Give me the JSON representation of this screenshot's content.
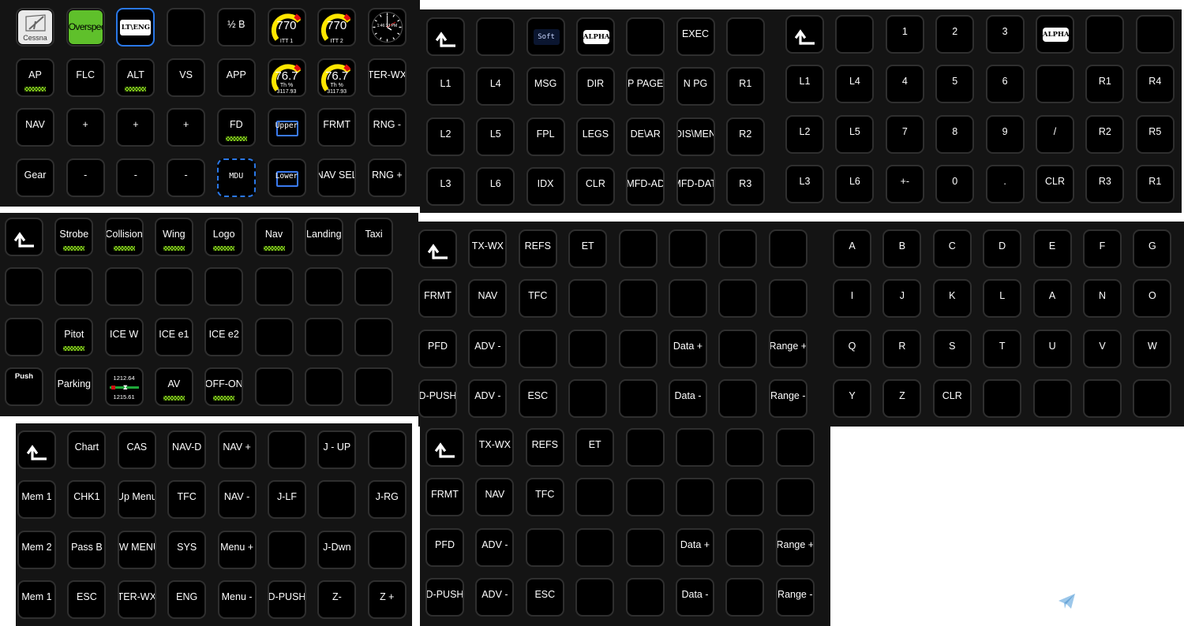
{
  "panels": [
    {
      "id": "main",
      "keys": [
        {
          "t": "logo",
          "label": "Cessna"
        },
        {
          "t": "overspeed",
          "label": "Overspeed"
        },
        {
          "t": "ltbox",
          "label": "LT\\ENG",
          "hl": true
        },
        {
          "t": "blank"
        },
        {
          "label": "½ B"
        },
        {
          "t": "gauge",
          "value": "770",
          "sub": "ITT 1"
        },
        {
          "t": "gauge",
          "value": "770",
          "sub": "ITT 2"
        },
        {
          "t": "clock",
          "label": "1:46:33 PM"
        },
        {
          "label": "AP",
          "bar": true
        },
        {
          "label": "FLC"
        },
        {
          "label": "ALT",
          "bar": true
        },
        {
          "label": "VS"
        },
        {
          "label": "APP"
        },
        {
          "t": "gauge",
          "value": "76.7",
          "sub": "Th %",
          "sub2": "3117.93"
        },
        {
          "t": "gauge",
          "value": "76.7",
          "sub": "Th %",
          "sub2": "3117.93"
        },
        {
          "label": "TER-WX"
        },
        {
          "label": "NAV"
        },
        {
          "label": "+"
        },
        {
          "label": "+"
        },
        {
          "label": "+"
        },
        {
          "label": "FD",
          "bar": true
        },
        {
          "t": "folder",
          "label": "Upper"
        },
        {
          "label": "FRMT"
        },
        {
          "label": "RNG -"
        },
        {
          "label": "Gear"
        },
        {
          "label": "-"
        },
        {
          "label": "-"
        },
        {
          "label": "-"
        },
        {
          "t": "mdu",
          "label": "MDU"
        },
        {
          "t": "folder",
          "label": "Lower"
        },
        {
          "label": "NAV SEL"
        },
        {
          "label": "RNG +"
        }
      ]
    },
    {
      "id": "fms1",
      "keys": [
        {
          "t": "back"
        },
        {
          "t": "blank"
        },
        {
          "t": "soft",
          "label": "Soft"
        },
        {
          "t": "alpha",
          "label": "ALPHA"
        },
        {
          "t": "blank"
        },
        {
          "label": "EXEC"
        },
        {
          "t": "blank"
        },
        {
          "label": "L1"
        },
        {
          "label": "L4"
        },
        {
          "label": "MSG"
        },
        {
          "label": "DIR"
        },
        {
          "label": "P PAGE"
        },
        {
          "label": "N PG"
        },
        {
          "label": "R1"
        },
        {
          "label": "L2"
        },
        {
          "label": "L5"
        },
        {
          "label": "FPL"
        },
        {
          "label": "LEGS"
        },
        {
          "label": "DE\\AR"
        },
        {
          "label": "DIS\\MEN"
        },
        {
          "label": "R2"
        },
        {
          "label": "L3"
        },
        {
          "label": "L6"
        },
        {
          "label": "IDX"
        },
        {
          "label": "CLR"
        },
        {
          "label": "MFD-AD"
        },
        {
          "label": "MFD-DATA"
        },
        {
          "label": "R3"
        }
      ]
    },
    {
      "id": "fms2",
      "keys": [
        {
          "t": "back"
        },
        {
          "t": "blank"
        },
        {
          "label": "1"
        },
        {
          "label": "2"
        },
        {
          "label": "3"
        },
        {
          "t": "alpha",
          "label": "ALPHA"
        },
        {
          "t": "blank"
        },
        {
          "t": "blank"
        },
        {
          "label": "L1"
        },
        {
          "label": "L4"
        },
        {
          "label": "4"
        },
        {
          "label": "5"
        },
        {
          "label": "6"
        },
        {
          "t": "blank"
        },
        {
          "label": "R1"
        },
        {
          "label": "R4"
        },
        {
          "label": "L2"
        },
        {
          "label": "L5"
        },
        {
          "label": "7"
        },
        {
          "label": "8"
        },
        {
          "label": "9"
        },
        {
          "label": "/"
        },
        {
          "label": "R2"
        },
        {
          "label": "R5"
        },
        {
          "label": "L3"
        },
        {
          "label": "L6"
        },
        {
          "label": "+-"
        },
        {
          "label": "0"
        },
        {
          "label": "."
        },
        {
          "label": "CLR"
        },
        {
          "label": "R3"
        },
        {
          "label": "R1"
        }
      ]
    },
    {
      "id": "lights",
      "keys": [
        {
          "t": "back"
        },
        {
          "label": "Strobe",
          "bar": true
        },
        {
          "label": "Collision",
          "bar": true
        },
        {
          "label": "Wing",
          "bar": true
        },
        {
          "label": "Logo",
          "bar": true
        },
        {
          "label": "Nav",
          "bar": true
        },
        {
          "label": "Landing"
        },
        {
          "label": "Taxi"
        },
        {
          "t": "blank"
        },
        {
          "t": "blank"
        },
        {
          "t": "blank"
        },
        {
          "t": "blank"
        },
        {
          "t": "blank"
        },
        {
          "t": "blank"
        },
        {
          "t": "blank"
        },
        {
          "t": "blank"
        },
        {
          "t": "blank"
        },
        {
          "label": "Pitot",
          "bar": true
        },
        {
          "label": "ICE W"
        },
        {
          "label": "ICE e1"
        },
        {
          "label": "ICE e2"
        },
        {
          "t": "blank"
        },
        {
          "t": "blank"
        },
        {
          "t": "blank"
        },
        {
          "t": "push",
          "label": "Push"
        },
        {
          "label": "Parking"
        },
        {
          "t": "baro",
          "top": "1212.64",
          "bottom": "1215.61"
        },
        {
          "label": "AV",
          "bar": true
        },
        {
          "label": "OFF-ON",
          "bar": true
        },
        {
          "t": "blank"
        },
        {
          "t": "blank"
        },
        {
          "t": "blank"
        }
      ]
    },
    {
      "id": "mfd1",
      "keys": [
        {
          "t": "back"
        },
        {
          "label": "TX-WX"
        },
        {
          "label": "REFS"
        },
        {
          "label": "ET"
        },
        {
          "t": "blank"
        },
        {
          "t": "blank"
        },
        {
          "t": "blank"
        },
        {
          "t": "blank"
        },
        {
          "label": "FRMT"
        },
        {
          "label": "NAV"
        },
        {
          "label": "TFC"
        },
        {
          "t": "blank"
        },
        {
          "t": "blank"
        },
        {
          "t": "blank"
        },
        {
          "t": "blank"
        },
        {
          "t": "blank"
        },
        {
          "label": "PFD"
        },
        {
          "label": "ADV -"
        },
        {
          "t": "blank"
        },
        {
          "t": "blank"
        },
        {
          "t": "blank"
        },
        {
          "label": "Data +"
        },
        {
          "t": "blank"
        },
        {
          "label": "Range +"
        },
        {
          "label": "D-PUSH"
        },
        {
          "label": "ADV -"
        },
        {
          "label": "ESC"
        },
        {
          "t": "blank"
        },
        {
          "t": "blank"
        },
        {
          "label": "Data -"
        },
        {
          "t": "blank"
        },
        {
          "label": "Range -"
        }
      ]
    },
    {
      "id": "alpha",
      "keys": [
        {
          "label": "A"
        },
        {
          "label": "B"
        },
        {
          "label": "C"
        },
        {
          "label": "D"
        },
        {
          "label": "E"
        },
        {
          "label": "F"
        },
        {
          "label": "G"
        },
        {
          "label": "I"
        },
        {
          "label": "J"
        },
        {
          "label": "K"
        },
        {
          "label": "L"
        },
        {
          "label": "A"
        },
        {
          "label": "N"
        },
        {
          "label": "O"
        },
        {
          "label": "Q"
        },
        {
          "label": "R"
        },
        {
          "label": "S"
        },
        {
          "label": "T"
        },
        {
          "label": "U"
        },
        {
          "label": "V"
        },
        {
          "label": "W"
        },
        {
          "label": "Y"
        },
        {
          "label": "Z"
        },
        {
          "label": "CLR"
        },
        {
          "t": "blank"
        },
        {
          "t": "blank"
        },
        {
          "t": "blank"
        },
        {
          "t": "blank"
        }
      ]
    },
    {
      "id": "chart",
      "keys": [
        {
          "t": "back"
        },
        {
          "label": "Chart"
        },
        {
          "label": "CAS"
        },
        {
          "label": "NAV-D"
        },
        {
          "label": "NAV +"
        },
        {
          "t": "blank"
        },
        {
          "label": "J - UP"
        },
        {
          "t": "blank"
        },
        {
          "label": "Mem 1"
        },
        {
          "label": "CHK1"
        },
        {
          "label": "Up Menu"
        },
        {
          "label": "TFC"
        },
        {
          "label": "NAV -"
        },
        {
          "label": "J-LF"
        },
        {
          "t": "blank"
        },
        {
          "label": "J-RG"
        },
        {
          "label": "Mem 2"
        },
        {
          "label": "Pass B"
        },
        {
          "label": "LW MENU"
        },
        {
          "label": "SYS"
        },
        {
          "label": "Menu +"
        },
        {
          "t": "blank"
        },
        {
          "label": "J-Dwn"
        },
        {
          "t": "blank"
        },
        {
          "label": "Mem 1"
        },
        {
          "label": "ESC"
        },
        {
          "label": "TER-WX"
        },
        {
          "label": "ENG"
        },
        {
          "label": "Menu -"
        },
        {
          "label": "D-PUSH"
        },
        {
          "label": "Z-"
        },
        {
          "label": "Z +"
        }
      ]
    },
    {
      "id": "mfd2",
      "keys": [
        {
          "t": "back"
        },
        {
          "label": "TX-WX"
        },
        {
          "label": "REFS"
        },
        {
          "label": "ET"
        },
        {
          "t": "blank"
        },
        {
          "t": "blank"
        },
        {
          "t": "blank"
        },
        {
          "t": "blank"
        },
        {
          "label": "FRMT"
        },
        {
          "label": "NAV"
        },
        {
          "label": "TFC"
        },
        {
          "t": "blank"
        },
        {
          "t": "blank"
        },
        {
          "t": "blank"
        },
        {
          "t": "blank"
        },
        {
          "t": "blank"
        },
        {
          "label": "PFD"
        },
        {
          "label": "ADV -"
        },
        {
          "t": "blank"
        },
        {
          "t": "blank"
        },
        {
          "t": "blank"
        },
        {
          "label": "Data +"
        },
        {
          "t": "blank"
        },
        {
          "label": "Range +"
        },
        {
          "label": "D-PUSH"
        },
        {
          "label": "ADV -"
        },
        {
          "label": "ESC"
        },
        {
          "t": "blank"
        },
        {
          "t": "blank"
        },
        {
          "label": "Data -"
        },
        {
          "t": "blank"
        },
        {
          "label": "Range -"
        }
      ]
    }
  ],
  "colors": {
    "accent": "#2a78e8",
    "active_bar": "#7fc21a",
    "overspeed": "#5fc02b",
    "gauge_yellow": "#ffe600",
    "gauge_red": "#e01010"
  },
  "icons": {
    "back": "corner-up-arrow-icon",
    "folder": "folder-icon",
    "share": "paper-plane-icon"
  }
}
